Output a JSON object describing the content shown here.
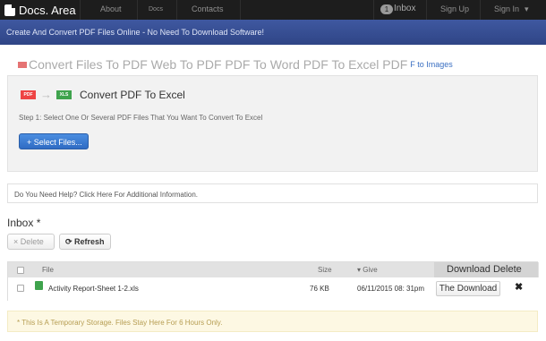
{
  "navbar": {
    "brand": "Docs. Area",
    "items": [
      "About",
      "Docs",
      "Contacts"
    ],
    "inbox_count": "1",
    "inbox_label": "Inbox",
    "sign_up": "Sign Up",
    "sign_in": "Sign In",
    "sign_in_caret": "▾"
  },
  "tagline": "Create And Convert PDF Files Online - No Need To Download Software!",
  "breadcrumb": {
    "main": "Convert Files To PDF Web To PDF PDF To Word PDF To Excel PDF",
    "tail": "F to Images"
  },
  "converter": {
    "pdf_badge": "PDF",
    "arrow": "→",
    "xls_badge": "XLS",
    "title": "Convert PDF To Excel",
    "step": "Step 1: Select One Or Several PDF Files That You Want To Convert To Excel",
    "select_button": "+ Select Files..."
  },
  "help": "Do You Need Help? Click Here For Additional Information.",
  "inbox": {
    "title": "Inbox *",
    "delete_button": "× Delete",
    "refresh_button": "⟳ Refresh"
  },
  "table": {
    "headers": {
      "file": "File",
      "size": "Size",
      "give": "▾ Give",
      "last": "Download Delete"
    },
    "rows": [
      {
        "file": "Activity Report-Sheet 1-2.xls",
        "size": "76 KB",
        "date": "06/11/2015 08: 31pm",
        "download": "The Download",
        "delete": "✖"
      }
    ]
  },
  "notice": "* This Is A Temporary Storage. Files Stay Here For 6 Hours Only."
}
